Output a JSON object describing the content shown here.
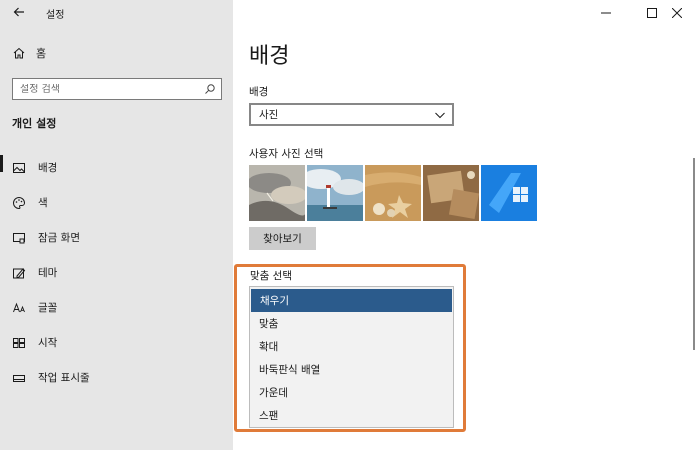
{
  "window": {
    "title": "설정",
    "controls": [
      "minimize",
      "maximize",
      "close"
    ]
  },
  "sidebar": {
    "home_label": "홈",
    "search_placeholder": "설정 검색",
    "section_title": "개인 설정",
    "items": [
      {
        "label": "배경",
        "icon": "picture-icon",
        "active": true
      },
      {
        "label": "색",
        "icon": "palette-icon",
        "active": false
      },
      {
        "label": "잠금 화면",
        "icon": "lock-screen-icon",
        "active": false
      },
      {
        "label": "테마",
        "icon": "theme-icon",
        "active": false
      },
      {
        "label": "글꼴",
        "icon": "font-icon",
        "active": false
      },
      {
        "label": "시작",
        "icon": "start-icon",
        "active": false
      },
      {
        "label": "작업 표시줄",
        "icon": "taskbar-icon",
        "active": false
      }
    ]
  },
  "main": {
    "page_title": "배경",
    "background_label": "배경",
    "background_value": "사진",
    "choose_photo_label": "사용자 사진 선택",
    "browse_label": "찾아보기",
    "fit_label": "맞춤 선택",
    "fit_options": [
      "채우기",
      "맞춤",
      "확대",
      "바둑판식 배열",
      "가운데",
      "스팬"
    ],
    "fit_selected": "채우기"
  },
  "colors": {
    "sidebar_bg": "#e6e6e6",
    "selected_bg": "#2b5b8c",
    "highlight": "#e07b39",
    "button_bg": "#cccccc"
  }
}
